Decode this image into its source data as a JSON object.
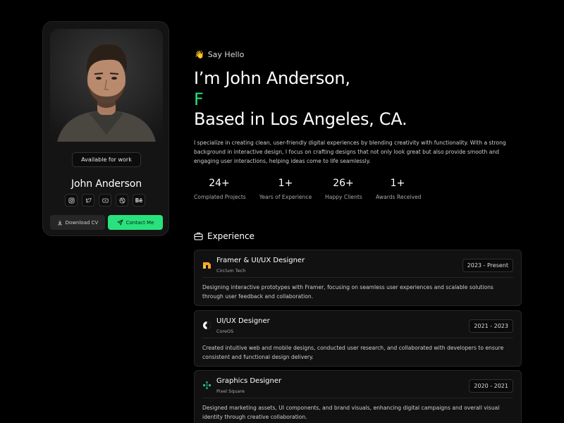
{
  "profile": {
    "availability": "Available for work",
    "name": "John Anderson",
    "social_icons": [
      "instagram-icon",
      "twitter-icon",
      "youtube-icon",
      "dribbble-icon",
      "behance-icon"
    ],
    "behance_text": "Bē",
    "download_label": "Download CV",
    "contact_label": "Contact Me"
  },
  "intro": {
    "greeting_emoji": "👋",
    "greeting": "Say Hello",
    "headline_1": "I’m John Anderson,",
    "headline_2": "F",
    "headline_3": "Based in Los Angeles, CA.",
    "bio": "I specialize in creating clean, user-friendly digital experiences by blending creativity with functionality. With a strong background in interactive design, I focus on crafting designs that not only look great but also provide smooth and engaging user interactions, helping ideas come to life seamlessly."
  },
  "stats": [
    {
      "value": "24+",
      "label": "Complated Projects"
    },
    {
      "value": "1+",
      "label": "Years of Experience"
    },
    {
      "value": "26+",
      "label": "Happy Clients"
    },
    {
      "value": "1+",
      "label": "Awards Received"
    }
  ],
  "experience": {
    "heading": "Experience",
    "items": [
      {
        "title": "Framer & UI/UX Designer",
        "company": "Circlum Tech",
        "period": "2023 - Present",
        "description": "Designing interactive prototypes with Framer, focusing on seamless user experiences and scalable solutions through user feedback and collaboration."
      },
      {
        "title": "UI/UX Designer",
        "company": "CoreOS",
        "period": "2021 - 2023",
        "description": "Created intuitive web and mobile designs, conducted user research, and collaborated with developers to ensure consistent and functional design delivery."
      },
      {
        "title": "Graphics Designer",
        "company": "Pixel Square",
        "period": "2020 - 2021",
        "description": "Designed marketing assets, UI components, and brand visuals, enhancing digital campaigns and overall visual identity through creative collaboration."
      }
    ]
  },
  "colors": {
    "accent": "#29e27d",
    "background": "#000000",
    "card": "#141414"
  }
}
